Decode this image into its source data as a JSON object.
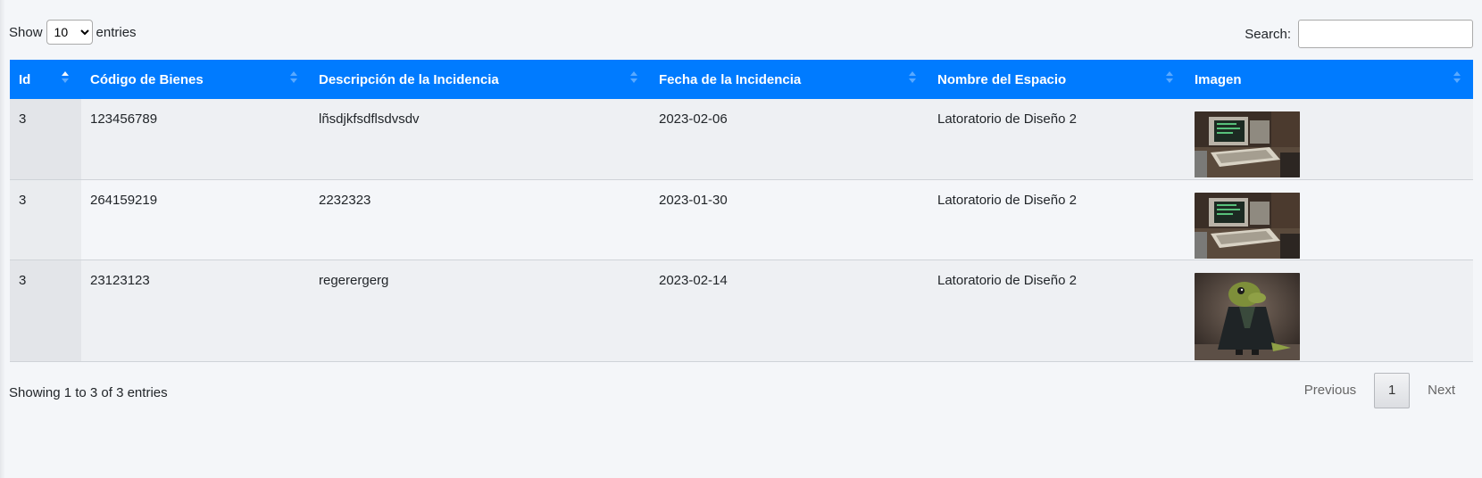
{
  "length": {
    "show_label": "Show",
    "selected": "10",
    "entries_label": "entries"
  },
  "search": {
    "label": "Search:",
    "value": ""
  },
  "table": {
    "headers": [
      "Id",
      "Código de Bienes",
      "Descripción de la Incidencia",
      "Fecha de la Incidencia",
      "Nombre del Espacio",
      "Imagen"
    ],
    "sorted_column": "Id",
    "rows": [
      {
        "id": "3",
        "codigo": "123456789",
        "descripcion": "lñsdjkfsdflsdvsdv",
        "fecha": "2023-02-06",
        "espacio": "Latoratorio de Diseño 2",
        "imagen": "computer-photo"
      },
      {
        "id": "3",
        "codigo": "264159219",
        "descripcion": "2232323",
        "fecha": "2023-01-30",
        "espacio": "Latoratorio de Diseño 2",
        "imagen": "computer-photo"
      },
      {
        "id": "3",
        "codigo": "23123123",
        "descripcion": "regerergerg",
        "fecha": "2023-02-14",
        "espacio": "Latoratorio de Diseño 2",
        "imagen": "dinosaur-photo"
      }
    ]
  },
  "footer": {
    "info": "Showing 1 to 3 of 3 entries"
  },
  "pager": {
    "previous": "Previous",
    "current": "1",
    "next": "Next"
  },
  "colors": {
    "header_bg": "#007bff",
    "page_bg": "#f4f6f9"
  }
}
